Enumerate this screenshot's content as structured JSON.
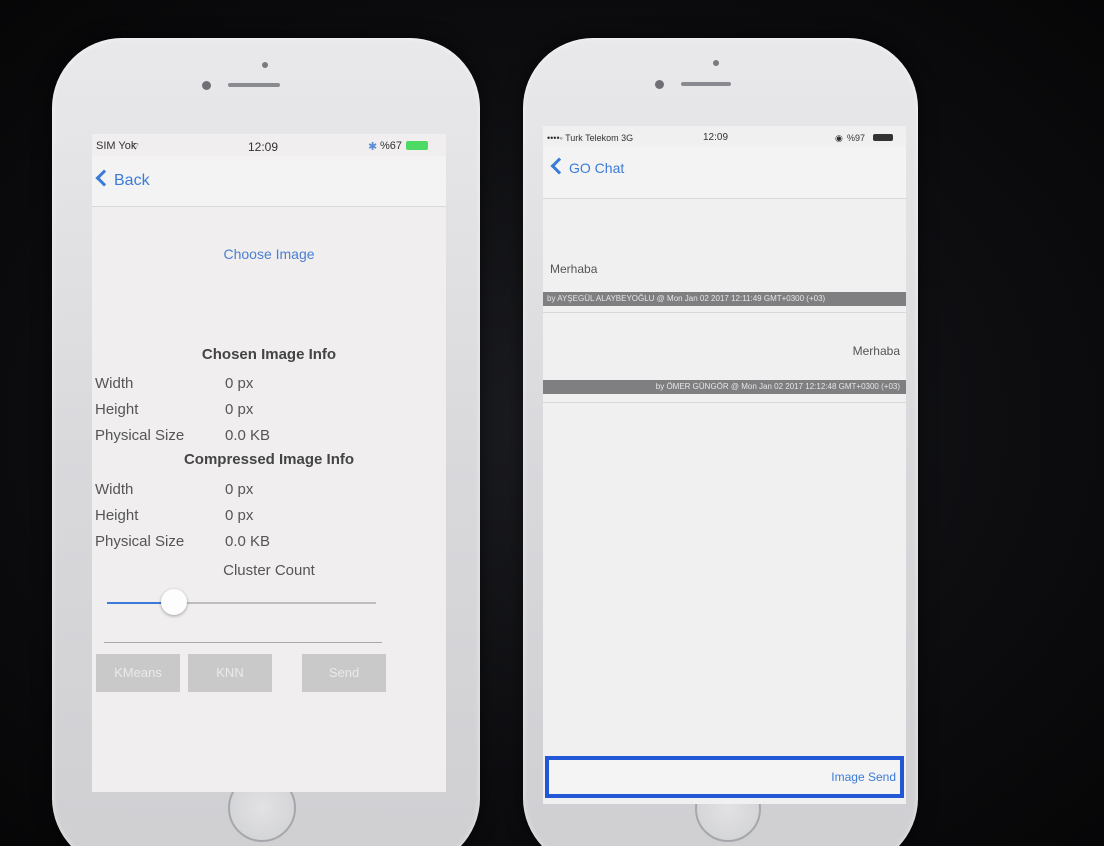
{
  "left_phone": {
    "status": {
      "carrier": "SIM Yok",
      "time": "12:09",
      "battery": "%67"
    },
    "nav": {
      "back_label": "Back"
    },
    "choose_image_label": "Choose Image",
    "chosen_info": {
      "title": "Chosen Image Info",
      "rows": [
        {
          "label": "Width",
          "value": "0 px"
        },
        {
          "label": "Height",
          "value": "0 px"
        },
        {
          "label": "Physical Size",
          "value": "0.0 KB"
        }
      ]
    },
    "compressed_info": {
      "title": "Compressed Image Info",
      "rows": [
        {
          "label": "Width",
          "value": "0 px"
        },
        {
          "label": "Height",
          "value": "0 px"
        },
        {
          "label": "Physical Size",
          "value": "0.0 KB"
        }
      ]
    },
    "cluster_label": "Cluster Count",
    "slider_fraction": 0.25,
    "buttons": {
      "kmeans": "KMeans",
      "knn": "KNN",
      "send": "Send"
    }
  },
  "right_phone": {
    "status": {
      "carrier": "••••◦ Turk Telekom  3G",
      "time": "12:09",
      "battery": "%97"
    },
    "nav": {
      "back_label": "GO Chat"
    },
    "messages": [
      {
        "text": "Merhaba",
        "meta": "by AYŞEGÜL ALAYBEYOĞLU @ Mon Jan 02 2017 12:11:49 GMT+0300 (+03)"
      },
      {
        "text": "Merhaba",
        "meta": "by ÖMER GÜNGÖR @ Mon Jan 02 2017 12:12:48 GMT+0300 (+03)"
      }
    ],
    "input": {
      "placeholder": ""
    },
    "image_send_label": "Image Send"
  },
  "colors": {
    "accent": "#3b7bd8",
    "input_border": "#2257d6",
    "button_disabled": "#c9c9c9",
    "meta_bar": "#7f7f82"
  }
}
